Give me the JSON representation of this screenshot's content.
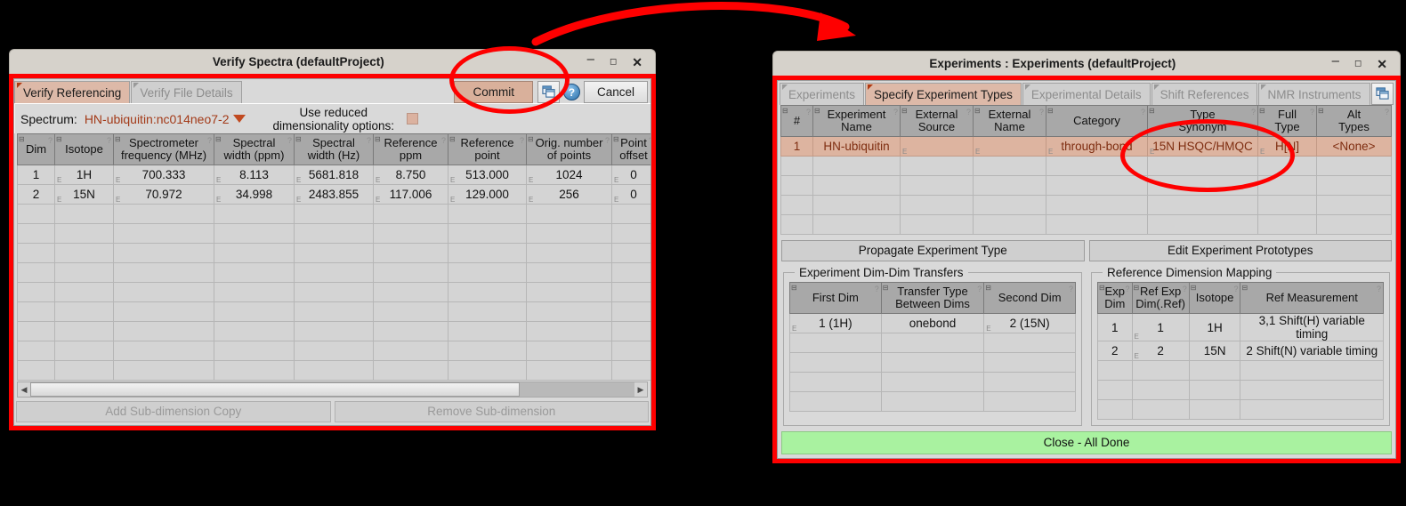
{
  "left_window": {
    "title": "Verify Spectra (defaultProject)",
    "window_buttons": {
      "minimize": "–",
      "maximize": "❐",
      "close": "✕"
    },
    "tabs": [
      {
        "label": "Verify Referencing",
        "active": true
      },
      {
        "label": "Verify File Details",
        "active": false
      }
    ],
    "toolbar": {
      "commit_label": "Commit",
      "cancel_label": "Cancel",
      "window_icon": "window-icon",
      "help_icon": "?"
    },
    "spectrum_row": {
      "label": "Spectrum:",
      "value": "HN-ubiquitin:nc014neo7-2",
      "reduced_dim_label_line1": "Use reduced",
      "reduced_dim_label_line2": "dimensionality options:",
      "checkbox_checked": false
    },
    "table": {
      "headers": [
        "Dim",
        "Isotope",
        "Spectrometer\nfrequency (MHz)",
        "Spectral\nwidth (ppm)",
        "Spectral\nwidth (Hz)",
        "Reference\nppm",
        "Reference\npoint",
        "Orig. number\nof points",
        "Point\noffset"
      ],
      "rows": [
        [
          "1",
          "1H",
          "700.333",
          "8.113",
          "5681.818",
          "8.750",
          "513.000",
          "1024",
          "0"
        ],
        [
          "2",
          "15N",
          "70.972",
          "34.998",
          "2483.855",
          "117.006",
          "129.000",
          "256",
          "0"
        ]
      ],
      "empty_row_count": 11
    },
    "bottom_buttons": [
      "Add Sub-dimension Copy",
      "Remove Sub-dimension"
    ]
  },
  "right_window": {
    "title": "Experiments : Experiments (defaultProject)",
    "window_buttons": {
      "minimize": "–",
      "maximize": "❐",
      "close": "✕"
    },
    "tabs": [
      {
        "label": "Experiments",
        "active": false
      },
      {
        "label": "Specify Experiment Types",
        "active": true
      },
      {
        "label": "Experimental Details",
        "active": false
      },
      {
        "label": "Shift References",
        "active": false
      },
      {
        "label": "NMR Instruments",
        "active": false
      }
    ],
    "toolbar": {
      "window_icon": "window-icon",
      "help_icon": "?"
    },
    "table": {
      "headers": [
        "#",
        "Experiment\nName",
        "External\nSource",
        "External\nName",
        "Category",
        "Type\nSynonym",
        "Full\nType",
        "Alt\nTypes"
      ],
      "rows": [
        [
          "1",
          "HN-ubiquitin",
          "",
          "",
          "through-bond",
          "15N HSQC/HMQC",
          "H[N]",
          "<None>"
        ]
      ],
      "empty_row_count": 4
    },
    "action_buttons": [
      "Propagate Experiment Type",
      "Edit Experiment Prototypes"
    ],
    "transfers_panel": {
      "title": "Experiment Dim-Dim Transfers",
      "headers": [
        "First Dim",
        "Transfer Type\nBetween Dims",
        "Second Dim"
      ],
      "rows": [
        [
          "1 (1H)",
          "onebond",
          "2 (15N)"
        ]
      ],
      "empty_row_count": 4
    },
    "mapping_panel": {
      "title": "Reference Dimension Mapping",
      "headers": [
        "Exp\nDim",
        "Ref Exp\nDim(.Ref)",
        "Isotope",
        "Ref Measurement"
      ],
      "rows": [
        [
          "1",
          "1",
          "1H",
          "3,1 Shift(H) variable timing"
        ],
        [
          "2",
          "2",
          "15N",
          "2 Shift(N) variable timing"
        ]
      ],
      "empty_row_count": 3
    },
    "close_button": "Close - All Done"
  },
  "annotations": {
    "accent_color": "#fe0000",
    "arrow": "curved-arrow-left-to-right",
    "ellipse_commit": "highlight-commit-button",
    "ellipse_type_synonym": "highlight-type-synonym-cell"
  }
}
